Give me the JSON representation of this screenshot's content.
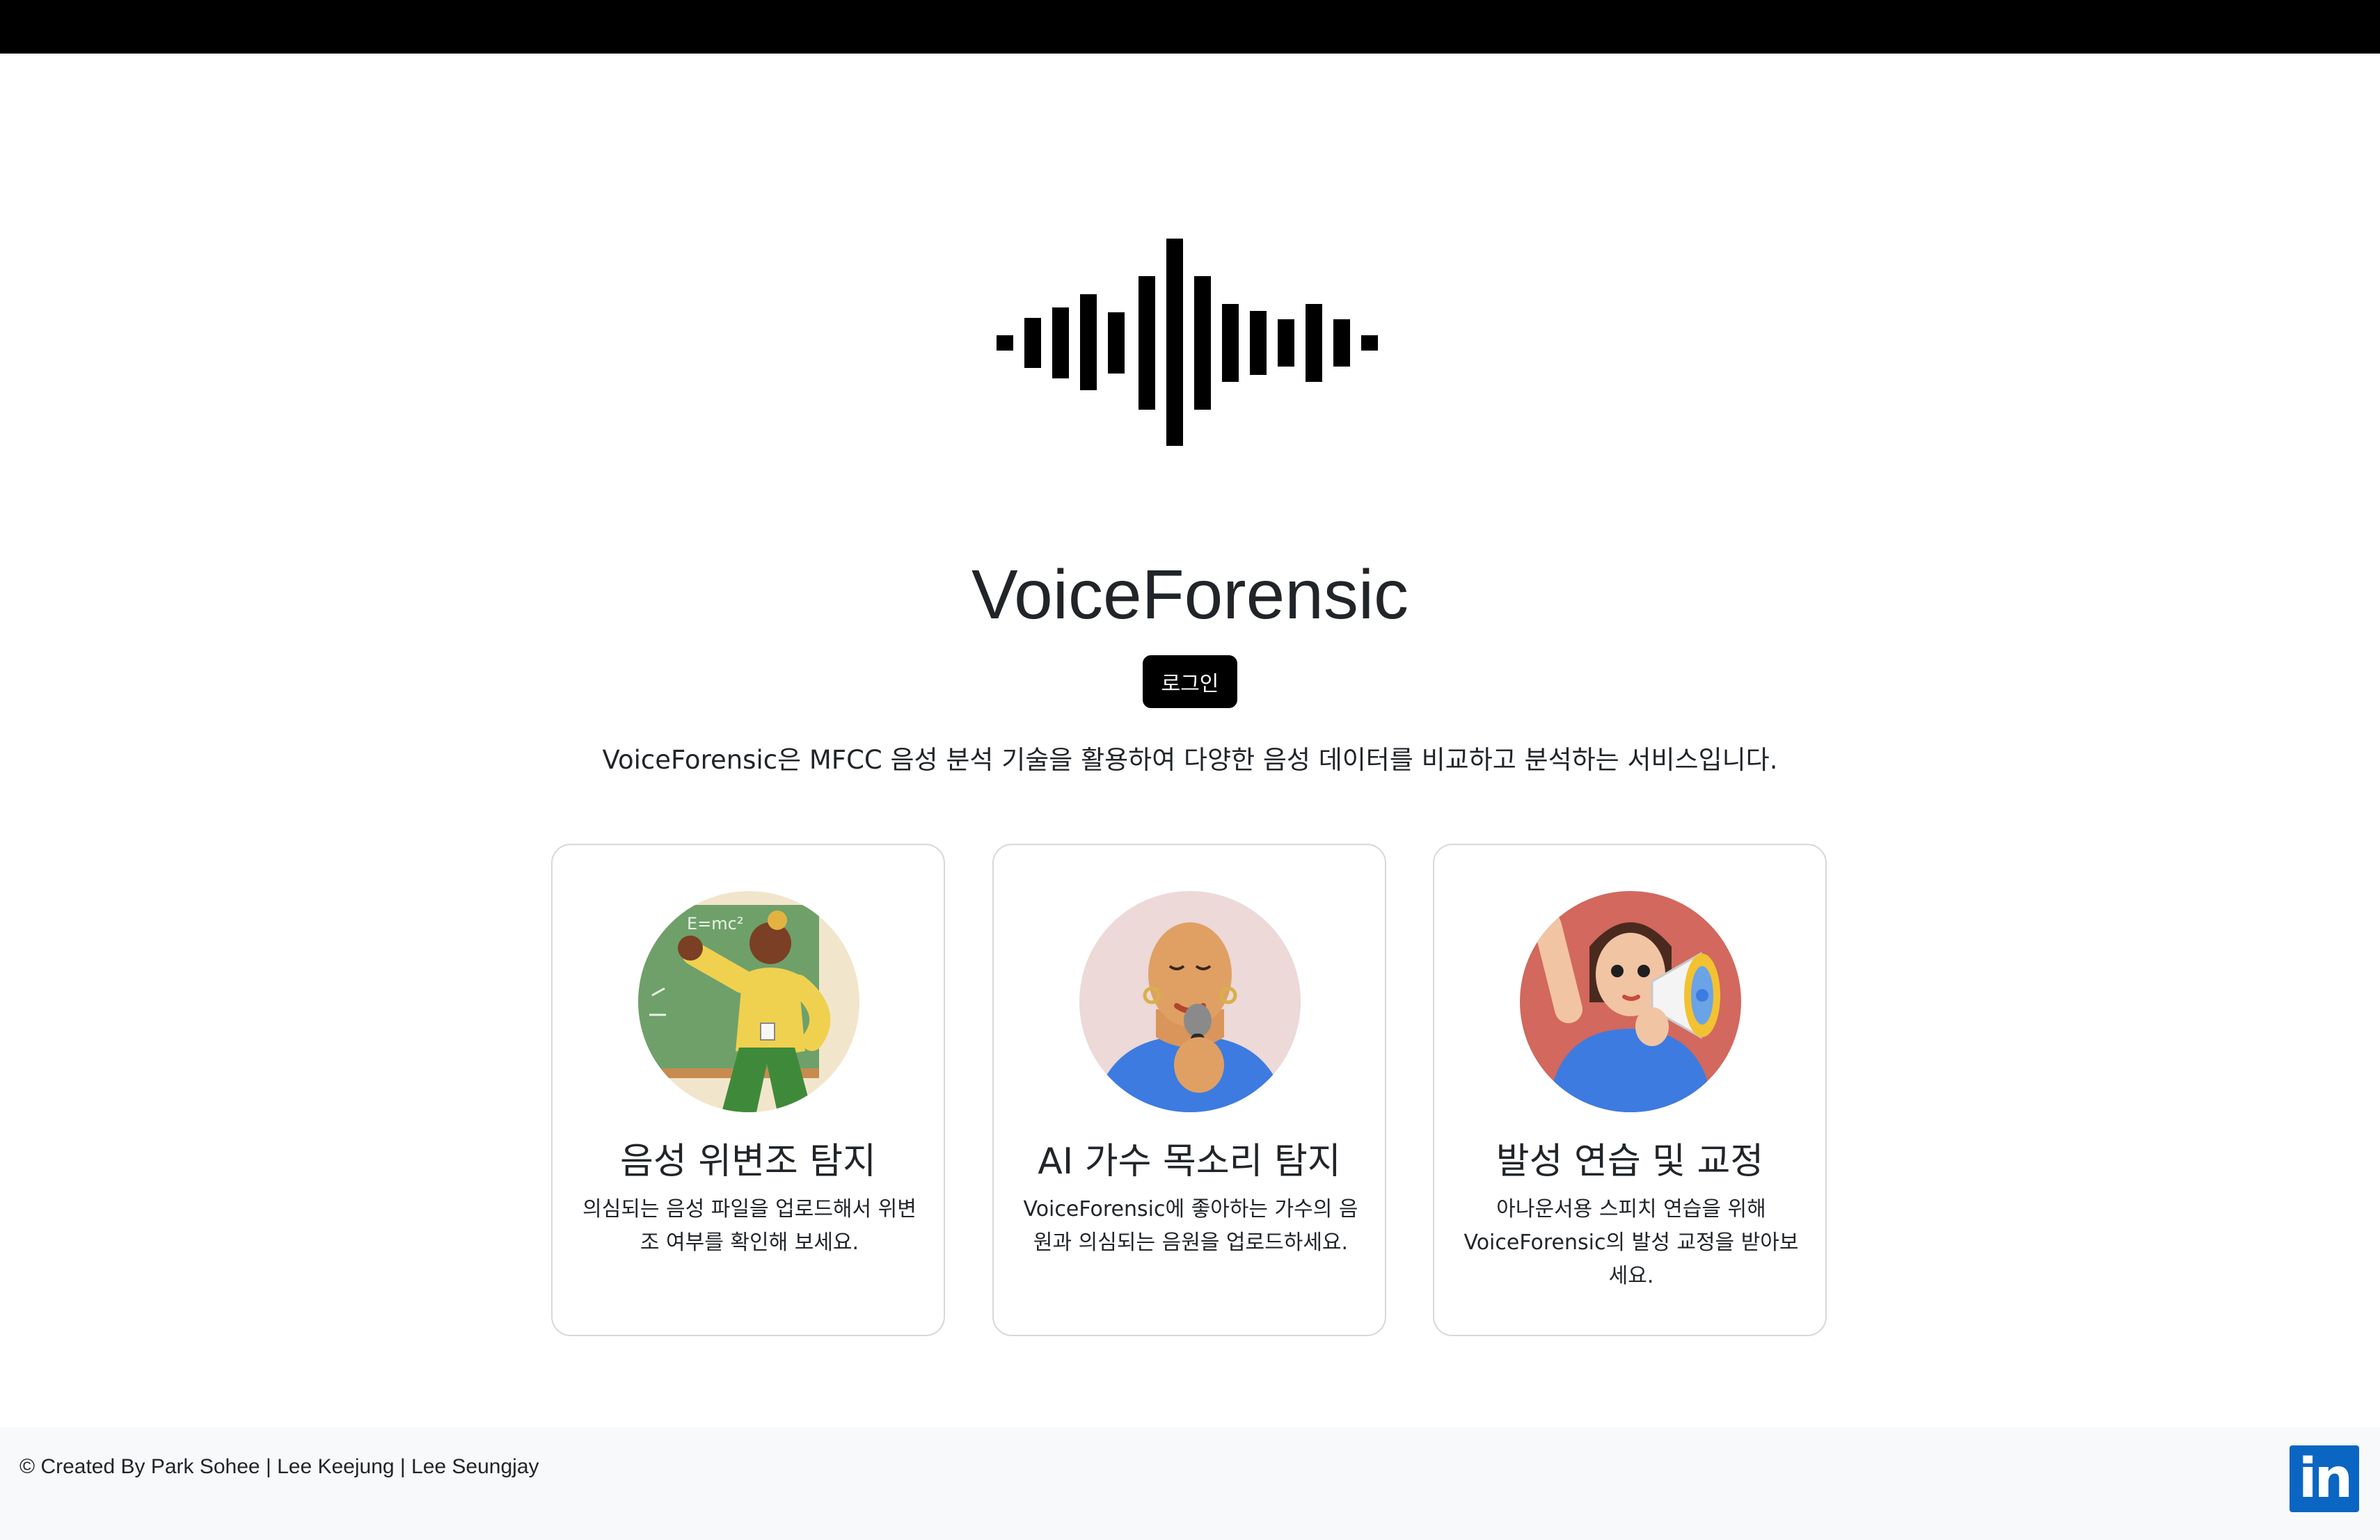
{
  "app": {
    "title": "VoiceForensic",
    "login_label": "로그인",
    "description": "VoiceForensic은 MFCC 음성 분석 기술을 활용하여 다양한 음성 데이터를 비교하고 분석하는 서비스입니다."
  },
  "logo": {
    "icon": "soundwave-icon",
    "color": "#000000"
  },
  "cards": [
    {
      "title": "음성 위변조 탐지",
      "text": "의심되는 음성 파일을 업로드해서 위변조 여부를 확인해 보세요.",
      "illustration": "teacher-illustration",
      "board_text": "E=mc²"
    },
    {
      "title": "AI 가수 목소리 탐지",
      "text": "VoiceForensic에 좋아하는 가수의 음원과 의심되는 음원을 업로드하세요.",
      "illustration": "singer-illustration"
    },
    {
      "title": "발성 연습 및 교정",
      "text": "아나운서용 스피치 연습을 위해 VoiceForensic의 발성 교정을 받아보세요.",
      "illustration": "megaphone-illustration"
    }
  ],
  "footer": {
    "copyright": "© Created By Park Sohee | Lee Keejung | Lee Seungjay",
    "social_icon": "linkedin-icon",
    "social_label": "in",
    "social_color": "#0a66c2"
  }
}
